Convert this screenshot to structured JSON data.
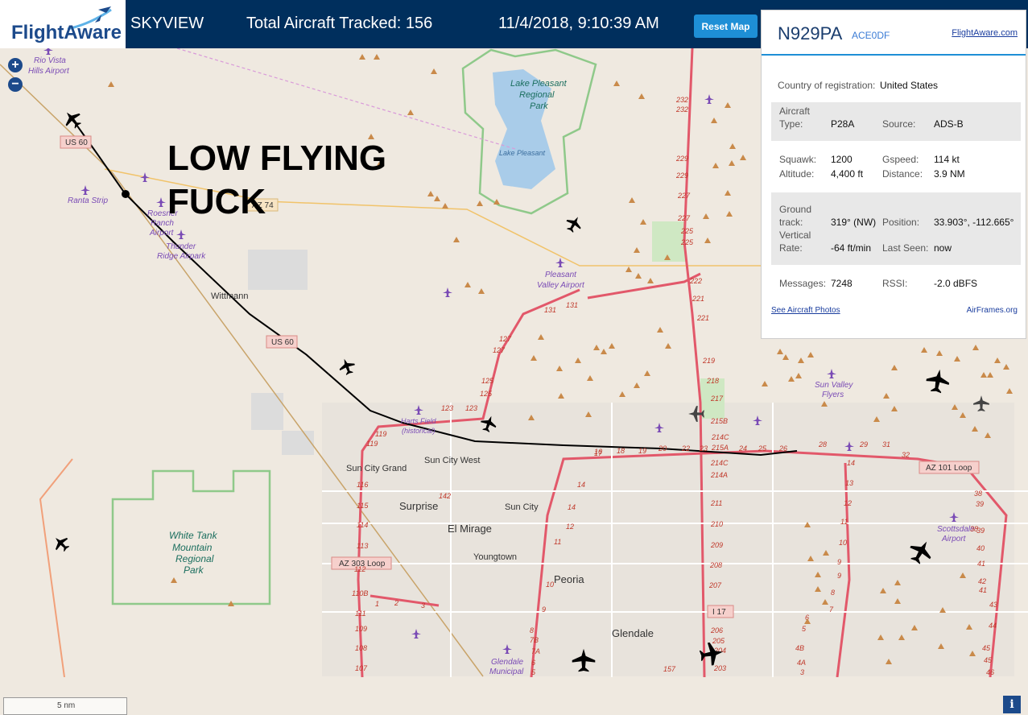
{
  "header": {
    "logo": "FlightAware",
    "app_name": "SKYVIEW",
    "total_tracked": "Total Aircraft Tracked: 156",
    "datetime": "11/4/2018, 9:10:39 AM",
    "reset_label": "Reset Map"
  },
  "overlay": {
    "line1": "LOW FLYING",
    "line2": "FUCK"
  },
  "zoom": {
    "in": "+",
    "out": "−"
  },
  "map": {
    "places": [
      "Rio Vista",
      "Hills Airport",
      "Lake Pleasant",
      "Regional",
      "Park",
      "Lake Pleasant",
      "Ranta Strip",
      "Roesner",
      "Ranch",
      "Airport",
      "Thunder",
      "Ridge Airpark",
      "Wittmann",
      "Pleasant",
      "Valley Airport",
      "Harts Field",
      "(historical)",
      "Sun City Grand",
      "Sun City West",
      "Surprise",
      "Sun City",
      "El Mirage",
      "Youngtown",
      "Peoria",
      "Glendale",
      "Glendale",
      "Municipal",
      "White Tank",
      "Mountain",
      "Regional",
      "Park",
      "Sun Valley",
      "Flyers",
      "Scottsdale",
      "Airport"
    ],
    "shields": [
      "US 60",
      "AZ 74",
      "US 60",
      "AZ 303 Loop",
      "I 17",
      "AZ 101 Loop"
    ],
    "exits_i17": [
      "232",
      "232",
      "229",
      "229",
      "227",
      "227",
      "225",
      "225",
      "222",
      "221",
      "221",
      "219",
      "218",
      "217",
      "215B",
      "214C",
      "215A",
      "214C",
      "214A",
      "211",
      "210",
      "209",
      "208",
      "207",
      "206",
      "205",
      "204",
      "203"
    ],
    "exits_303": [
      "131",
      "131",
      "127",
      "127",
      "125",
      "125",
      "123",
      "123",
      "119",
      "119",
      "116",
      "115",
      "114",
      "113",
      "112",
      "110B",
      "111",
      "109",
      "108",
      "107"
    ],
    "exits_101_w": [
      "17",
      "16",
      "14",
      "14",
      "12",
      "11",
      "10",
      "9",
      "8",
      "7B",
      "7A",
      "6",
      "5"
    ],
    "exits_101_n": [
      "18",
      "19",
      "20",
      "22",
      "23",
      "24",
      "25",
      "26",
      "28",
      "29",
      "31",
      "32"
    ],
    "exits_101_e": [
      "14",
      "13",
      "12",
      "11",
      "10",
      "9",
      "9",
      "8",
      "7",
      "6",
      "5",
      "4B",
      "4A",
      "3"
    ],
    "exits_101_s": [
      "38",
      "39",
      "38",
      "39",
      "40",
      "41",
      "42",
      "41",
      "43",
      "44",
      "45",
      "45",
      "46"
    ],
    "misc": [
      "142",
      "1",
      "2",
      "3",
      "157"
    ],
    "scale": "5 nm",
    "info": "i"
  },
  "panel": {
    "registration": "N929PA",
    "hex": "ACE0DF",
    "fa_link": "FlightAware.com",
    "country_label": "Country of registration:",
    "country_value": "United States",
    "aircraft_type_label_1": "Aircraft",
    "aircraft_type_label_2": "Type:",
    "aircraft_type_value": "P28A",
    "source_label": "Source:",
    "source_value": "ADS-B",
    "squawk_label": "Squawk:",
    "squawk_value": "1200",
    "gspeed_label": "Gspeed:",
    "gspeed_value": "114 kt",
    "altitude_label": "Altitude:",
    "altitude_value": "4,400 ft",
    "distance_label": "Distance:",
    "distance_value": "3.9 NM",
    "gtrack_label_1": "Ground",
    "gtrack_label_2": "track:",
    "gtrack_value": "319° (NW)",
    "position_label": "Position:",
    "position_value": "33.903°, -112.665°",
    "vrate_label_1": "Vertical",
    "vrate_label_2": "Rate:",
    "vrate_value": "-64 ft/min",
    "lastseen_label": "Last Seen:",
    "lastseen_value": "now",
    "messages_label": "Messages:",
    "messages_value": "7248",
    "rssi_label": "RSSI:",
    "rssi_value": "-2.0 dBFS",
    "photos_link": "See Aircraft Photos",
    "airframes_link": "AirFrames.org"
  },
  "colors": {
    "header_bg": "#002f5d",
    "accent": "#1e8fd6",
    "route": "#e2586a",
    "track": "#000000"
  }
}
